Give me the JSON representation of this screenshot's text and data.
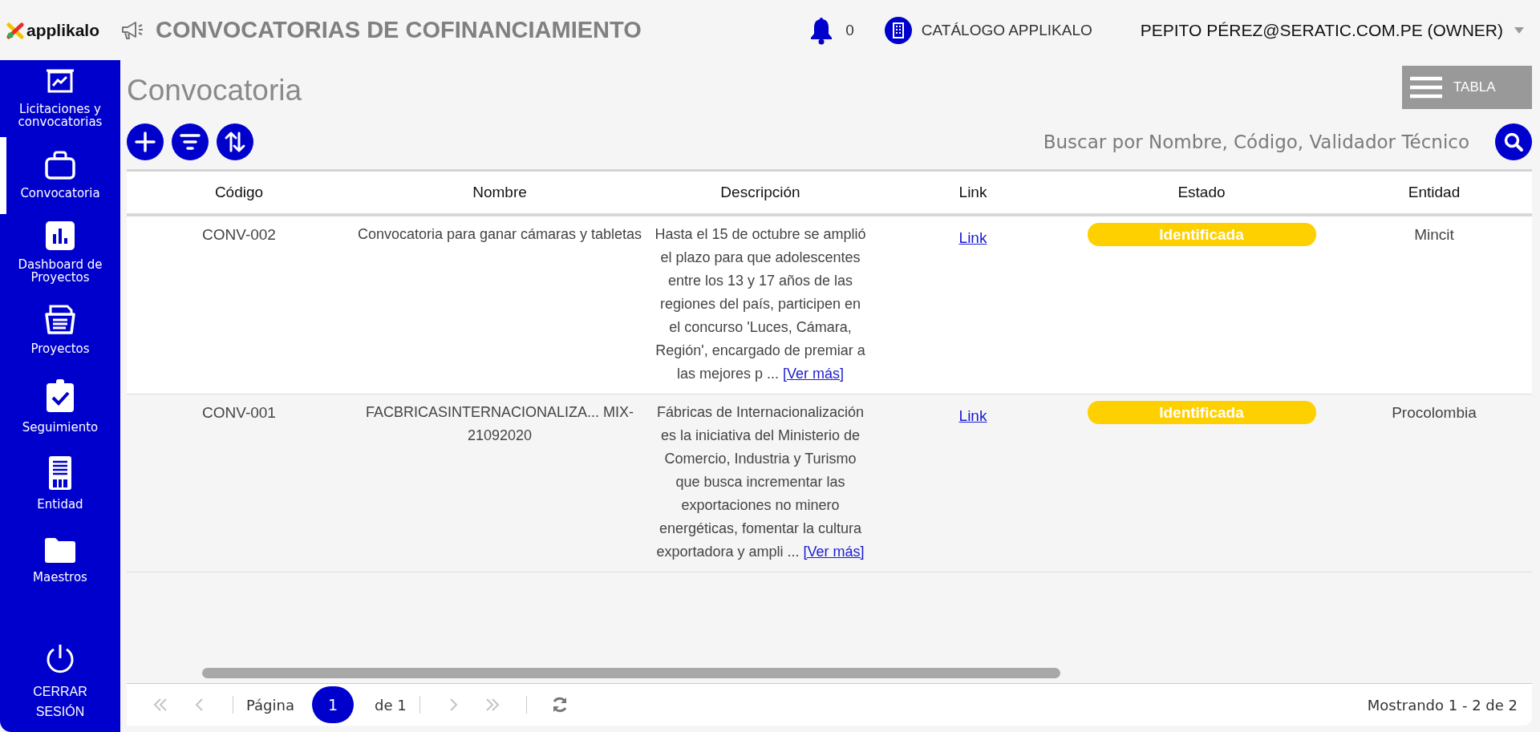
{
  "header": {
    "logo": "applikalo",
    "title": "CONVOCATORIAS DE COFINANCIAMIENTO",
    "notifications": "0",
    "catalog": "CATÁLOGO APPLIKALO",
    "user": "PEPITO PÉREZ@SERATIC.COM.PE (OWNER)"
  },
  "sidebar": {
    "items": [
      {
        "label": "Licitaciones y convocatorias",
        "selected": false
      },
      {
        "label": "Convocatoria",
        "selected": true
      },
      {
        "label": "Dashboard de Proyectos",
        "selected": false
      },
      {
        "label": "Proyectos",
        "selected": false
      },
      {
        "label": "Seguimiento",
        "selected": false
      },
      {
        "label": "Entidad",
        "selected": false
      },
      {
        "label": "Maestros",
        "selected": false
      }
    ],
    "logout": "CERRAR SESIÓN"
  },
  "page": {
    "title": "Convocatoria",
    "view_button": "TABLA",
    "search": {
      "placeholder": "Buscar por Nombre, Código, Validador Técnico"
    }
  },
  "table": {
    "columns": [
      "Código",
      "Nombre",
      "Descripción",
      "Link",
      "Estado",
      "Entidad"
    ],
    "rows": [
      {
        "code": "CONV-002",
        "name": "Convocatoria para ganar cámaras y tabletas",
        "description": "Hasta el 15 de octubre se amplió el plazo para que adolescentes entre los 13 y 17 años de las regiones del país, participen en el concurso 'Luces, Cámara, Región', encargado de premiar a las mejores p ...",
        "more": "[Ver más]",
        "link": "Link",
        "status": "Identificada",
        "entity": "Mincit"
      },
      {
        "code": "CONV-001",
        "name": "FACBRICASINTERNACIONALIZA... MIX-21092020",
        "description": "Fábricas de Internacionalización es la iniciativa del Ministerio de Comercio, Industria y Turismo que busca incrementar las exportaciones no minero energéticas, fomentar la cultura exportadora y ampli ...",
        "more": "[Ver más]",
        "link": "Link",
        "status": "Identificada",
        "entity": "Procolombia"
      }
    ]
  },
  "pager": {
    "first": {
      "disabled": true
    },
    "prev": {
      "disabled": true
    },
    "label": "Página",
    "page": "1",
    "total": "de 1",
    "next": {
      "disabled": true
    },
    "last": {
      "disabled": true
    },
    "summary": "Mostrando 1 - 2 de 2"
  }
}
